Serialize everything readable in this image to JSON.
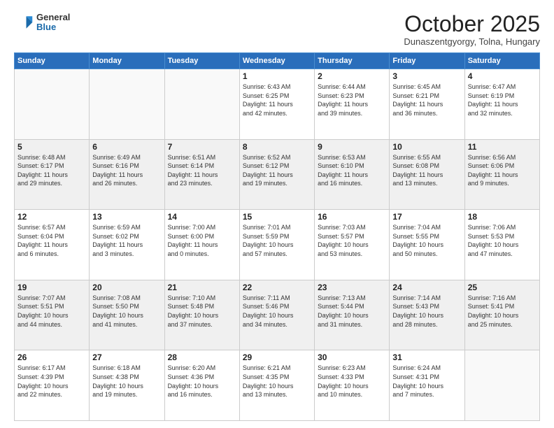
{
  "header": {
    "logo_general": "General",
    "logo_blue": "Blue",
    "month": "October 2025",
    "location": "Dunaszentgyorgy, Tolna, Hungary"
  },
  "weekdays": [
    "Sunday",
    "Monday",
    "Tuesday",
    "Wednesday",
    "Thursday",
    "Friday",
    "Saturday"
  ],
  "weeks": [
    [
      {
        "day": "",
        "info": ""
      },
      {
        "day": "",
        "info": ""
      },
      {
        "day": "",
        "info": ""
      },
      {
        "day": "1",
        "info": "Sunrise: 6:43 AM\nSunset: 6:25 PM\nDaylight: 11 hours\nand 42 minutes."
      },
      {
        "day": "2",
        "info": "Sunrise: 6:44 AM\nSunset: 6:23 PM\nDaylight: 11 hours\nand 39 minutes."
      },
      {
        "day": "3",
        "info": "Sunrise: 6:45 AM\nSunset: 6:21 PM\nDaylight: 11 hours\nand 36 minutes."
      },
      {
        "day": "4",
        "info": "Sunrise: 6:47 AM\nSunset: 6:19 PM\nDaylight: 11 hours\nand 32 minutes."
      }
    ],
    [
      {
        "day": "5",
        "info": "Sunrise: 6:48 AM\nSunset: 6:17 PM\nDaylight: 11 hours\nand 29 minutes."
      },
      {
        "day": "6",
        "info": "Sunrise: 6:49 AM\nSunset: 6:16 PM\nDaylight: 11 hours\nand 26 minutes."
      },
      {
        "day": "7",
        "info": "Sunrise: 6:51 AM\nSunset: 6:14 PM\nDaylight: 11 hours\nand 23 minutes."
      },
      {
        "day": "8",
        "info": "Sunrise: 6:52 AM\nSunset: 6:12 PM\nDaylight: 11 hours\nand 19 minutes."
      },
      {
        "day": "9",
        "info": "Sunrise: 6:53 AM\nSunset: 6:10 PM\nDaylight: 11 hours\nand 16 minutes."
      },
      {
        "day": "10",
        "info": "Sunrise: 6:55 AM\nSunset: 6:08 PM\nDaylight: 11 hours\nand 13 minutes."
      },
      {
        "day": "11",
        "info": "Sunrise: 6:56 AM\nSunset: 6:06 PM\nDaylight: 11 hours\nand 9 minutes."
      }
    ],
    [
      {
        "day": "12",
        "info": "Sunrise: 6:57 AM\nSunset: 6:04 PM\nDaylight: 11 hours\nand 6 minutes."
      },
      {
        "day": "13",
        "info": "Sunrise: 6:59 AM\nSunset: 6:02 PM\nDaylight: 11 hours\nand 3 minutes."
      },
      {
        "day": "14",
        "info": "Sunrise: 7:00 AM\nSunset: 6:00 PM\nDaylight: 11 hours\nand 0 minutes."
      },
      {
        "day": "15",
        "info": "Sunrise: 7:01 AM\nSunset: 5:59 PM\nDaylight: 10 hours\nand 57 minutes."
      },
      {
        "day": "16",
        "info": "Sunrise: 7:03 AM\nSunset: 5:57 PM\nDaylight: 10 hours\nand 53 minutes."
      },
      {
        "day": "17",
        "info": "Sunrise: 7:04 AM\nSunset: 5:55 PM\nDaylight: 10 hours\nand 50 minutes."
      },
      {
        "day": "18",
        "info": "Sunrise: 7:06 AM\nSunset: 5:53 PM\nDaylight: 10 hours\nand 47 minutes."
      }
    ],
    [
      {
        "day": "19",
        "info": "Sunrise: 7:07 AM\nSunset: 5:51 PM\nDaylight: 10 hours\nand 44 minutes."
      },
      {
        "day": "20",
        "info": "Sunrise: 7:08 AM\nSunset: 5:50 PM\nDaylight: 10 hours\nand 41 minutes."
      },
      {
        "day": "21",
        "info": "Sunrise: 7:10 AM\nSunset: 5:48 PM\nDaylight: 10 hours\nand 37 minutes."
      },
      {
        "day": "22",
        "info": "Sunrise: 7:11 AM\nSunset: 5:46 PM\nDaylight: 10 hours\nand 34 minutes."
      },
      {
        "day": "23",
        "info": "Sunrise: 7:13 AM\nSunset: 5:44 PM\nDaylight: 10 hours\nand 31 minutes."
      },
      {
        "day": "24",
        "info": "Sunrise: 7:14 AM\nSunset: 5:43 PM\nDaylight: 10 hours\nand 28 minutes."
      },
      {
        "day": "25",
        "info": "Sunrise: 7:16 AM\nSunset: 5:41 PM\nDaylight: 10 hours\nand 25 minutes."
      }
    ],
    [
      {
        "day": "26",
        "info": "Sunrise: 6:17 AM\nSunset: 4:39 PM\nDaylight: 10 hours\nand 22 minutes."
      },
      {
        "day": "27",
        "info": "Sunrise: 6:18 AM\nSunset: 4:38 PM\nDaylight: 10 hours\nand 19 minutes."
      },
      {
        "day": "28",
        "info": "Sunrise: 6:20 AM\nSunset: 4:36 PM\nDaylight: 10 hours\nand 16 minutes."
      },
      {
        "day": "29",
        "info": "Sunrise: 6:21 AM\nSunset: 4:35 PM\nDaylight: 10 hours\nand 13 minutes."
      },
      {
        "day": "30",
        "info": "Sunrise: 6:23 AM\nSunset: 4:33 PM\nDaylight: 10 hours\nand 10 minutes."
      },
      {
        "day": "31",
        "info": "Sunrise: 6:24 AM\nSunset: 4:31 PM\nDaylight: 10 hours\nand 7 minutes."
      },
      {
        "day": "",
        "info": ""
      }
    ]
  ]
}
